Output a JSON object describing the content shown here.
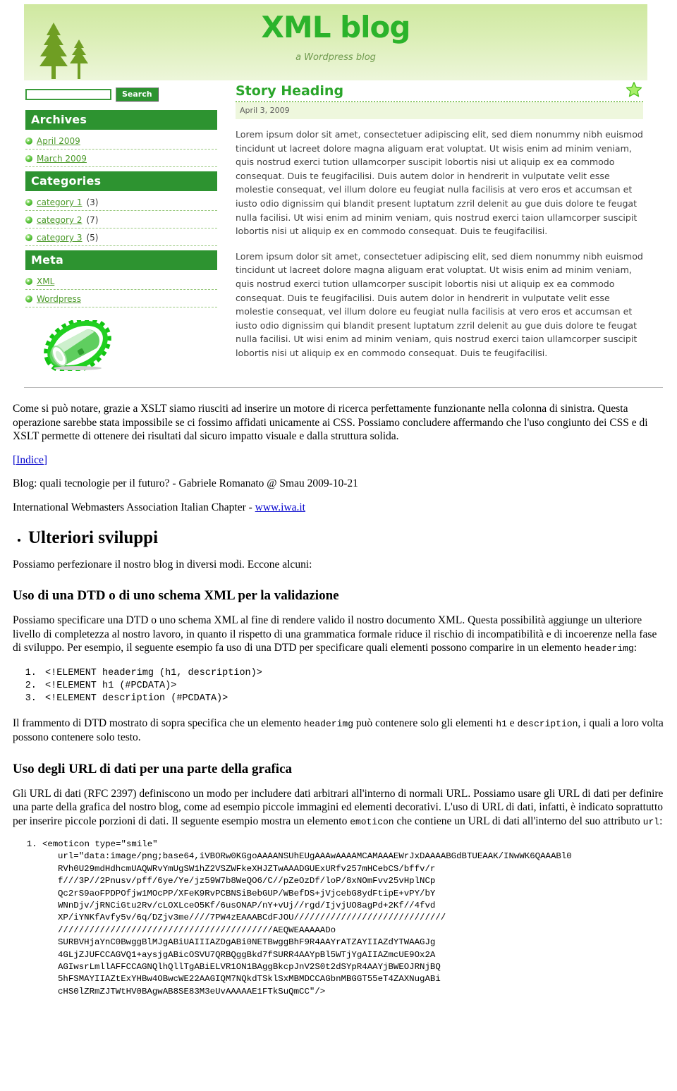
{
  "screenshot": {
    "blog": {
      "title": "XML blog",
      "tagline": "a Wordpress blog",
      "search": {
        "value": "",
        "placeholder": "",
        "button_label": "Search"
      },
      "widgets": [
        {
          "heading": "Archives",
          "items": [
            {
              "label": "April 2009",
              "count": ""
            },
            {
              "label": "March 2009",
              "count": ""
            }
          ]
        },
        {
          "heading": "Categories",
          "items": [
            {
              "label": "category 1",
              "count": "(3)"
            },
            {
              "label": "category 2",
              "count": "(7)"
            },
            {
              "label": "category 3",
              "count": "(5)"
            }
          ]
        },
        {
          "heading": "Meta",
          "items": [
            {
              "label": "XML",
              "count": ""
            },
            {
              "label": "Wordpress",
              "count": ""
            }
          ]
        }
      ],
      "post": {
        "title": "Story Heading",
        "date": "April 3, 2009",
        "paragraphs": [
          "Lorem ipsum dolor sit amet, consectetuer adipiscing elit, sed diem nonummy nibh euismod tincidunt ut lacreet dolore magna aliguam erat voluptat. Ut wisis enim ad minim veniam, quis nostrud exerci tution ullamcorper suscipit lobortis nisi ut aliquip ex ea commodo consequat. Duis te feugifacilisi. Duis autem dolor in hendrerit in vulputate velit esse molestie consequat, vel illum dolore eu feugiat nulla facilisis at vero eros et accumsan et iusto odio dignissim qui blandit present luptatum zzril delenit au gue duis dolore te feugat nulla facilisi. Ut wisi enim ad minim veniam, quis nostrud exerci taion ullamcorper suscipit lobortis nisi ut aliquip ex en commodo consequat. Duis te feugifacilisi.",
          "Lorem ipsum dolor sit amet, consectetuer adipiscing elit, sed diem nonummy nibh euismod tincidunt ut lacreet dolore magna aliguam erat voluptat. Ut wisis enim ad minim veniam, quis nostrud exerci tution ullamcorper suscipit lobortis nisi ut aliquip ex ea commodo consequat. Duis te feugifacilisi. Duis autem dolor in hendrerit in vulputate velit esse molestie consequat, vel illum dolore eu feugiat nulla facilisis at vero eros et accumsan et iusto odio dignissim qui blandit present luptatum zzril delenit au gue duis dolore te feugat nulla facilisi. Ut wisi enim ad minim veniam, quis nostrud exerci taion ullamcorper suscipit lobortis nisi ut aliquip ex en commodo consequat. Duis te feugifacilisi."
        ]
      }
    },
    "colors": {
      "header_gradient_top": "#cfe8a0",
      "header_gradient_bottom": "#edf6da",
      "title_green": "#2bb32b",
      "widget_bar_green": "#2d9330",
      "link_green": "#4c9a2a",
      "date_bg": "#eef7dd",
      "star_green": "#66e02a"
    }
  },
  "document": {
    "intro_paragraph": "Come si può notare, grazie a XSLT siamo riusciti ad inserire un motore di ricerca perfettamente funzionante nella colonna di sinistra. Questa operazione sarebbe stata impossibile se ci fossimo affidati unicamente ai CSS. Possiamo concludere affermando che l'uso congiunto dei CSS e di XSLT permette di ottenere dei risultati dal sicuro impatto visuale e dalla struttura solida.",
    "index_link": "[Indice]",
    "byline": "Blog: quali tecnologie per il futuro? - Gabriele Romanato @ Smau 2009-10-21",
    "association_prefix": "International Webmasters Association Italian Chapter - ",
    "association_link": "www.iwa.it",
    "section_title": "Ulteriori sviluppi",
    "section_intro": "Possiamo perfezionare il nostro blog in diversi modi. Eccone alcuni:",
    "subsection_1": {
      "heading": "Uso di una DTD o di uno schema XML per la validazione",
      "paragraph_before": "Possiamo specificare una DTD o uno schema XML al fine di rendere valido il nostro documento XML. Questa possibilità aggiunge un ulteriore livello di completezza al nostro lavoro, in quanto il rispetto di una grammatica formale riduce il rischio di incompatibilità e di incoerenze nella fase di sviluppo. Per esempio, il seguente esempio fa uso di una DTD per specificare quali elementi possono comparire in un elemento ",
      "paragraph_before_code": "headerimg",
      "paragraph_before_tail": ":",
      "code_lines": [
        "<!ELEMENT headerimg (h1, description)>",
        "<!ELEMENT h1 (#PCDATA)>",
        "<!ELEMENT description (#PCDATA)>"
      ],
      "paragraph_after_a": "Il frammento di DTD mostrato di sopra specifica che un elemento ",
      "paragraph_after_code1": "headerimg",
      "paragraph_after_b": " può contenere solo gli elementi ",
      "paragraph_after_code2": "h1",
      "paragraph_after_c": " e ",
      "paragraph_after_code3": "description",
      "paragraph_after_d": ", i quali a loro volta possono contenere solo testo."
    },
    "subsection_2": {
      "heading": "Uso degli URL di dati per una parte della grafica",
      "paragraph_a": "Gli URL di dati (RFC 2397) definiscono un modo per includere dati arbitrari all'interno di normali URL. Possiamo usare gli URL di dati per definire una parte della grafica del nostro blog, come ad esempio piccole immagini ed elementi decorativi. L'uso di URL di dati, infatti, è indicato soprattutto per inserire piccole porzioni di dati. Il seguente esempio mostra un elemento ",
      "paragraph_code1": "emoticon",
      "paragraph_b": " che contiene un URL di dati all'interno del suo attributo ",
      "paragraph_code2": "url",
      "paragraph_c": ":",
      "data_url_lines": [
        "<emoticon type=\"smile\"",
        "url=\"data:image/png;base64,iVBORw0KGgoAAAANSUhEUgAAAwAAAAMCAMAAAEWrJxDAAAABGdBTUEAAK/INwWK6QAAABl0",
        "RVh0U29mdHdhcmUAQWRvYmUgSW1hZ2VSZWFkeXHJZTwAAADGUExURfv257mHCebCS/bffv/r",
        "f///3P//2Pnusv/pff/6ye/Ye/jz59W7b8WeQO6/C//pZeOzDf/loP/8xNOmFvv25vHplNCp",
        "Qc2rS9aoFPDPOfjw1MOcPP/XFeK9RvPCBNSiBebGUP/WBefDS+jVjcebG8ydFtipE+vPY/bY",
        "WNnDjv/jRNCiGtu2Rv/cLOXLceO5Kf/6usONAP/nY+vUj//rgd/IjvjUO8agPd+2Kf//4fvd",
        "XP/iYNKfAvfy5v/6q/DZjv3me////7PW4zEAAABCdFJOU/////////////////////////////",
        "/////////////////////////////////////////AEQWEAAAAADo",
        "SURBVHjaYnC0BwggBlMJgABiUAIIIAZDgABi0NETBwggBhF9R4AAYrATZAYIIAZdYTWAAGJg",
        "4GLjZJUFCCAGVQ1+aysjgABicOSVU7QRBQggBkd7fSURR4AAYpBl5WTjYgAIIAZmcUE9Ox2A",
        "AGIwsrLmllAFFCCAGNQlhQllTgABiELVR1ON1BAggBkcpJnV2S0t2dSYpR4AAYjBWEOJRNjBQ",
        "5hFSMAYIIAZtExYHBw4OBwcWE22AAGIQM7NQkdTSklSxMBMDCCAGbnMBGGT55eT4ZAXNugABi",
        "cHS0lZRmZJTWtHV0BAgwAB8SE83M3eUvAAAAAE1FTkSuQmCC\"/>"
      ]
    }
  }
}
